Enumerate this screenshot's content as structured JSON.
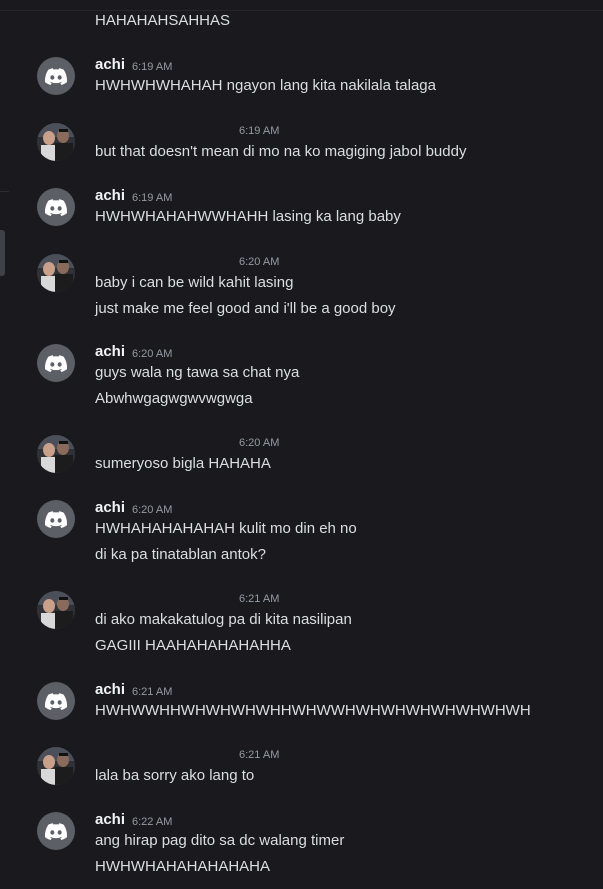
{
  "messages": [
    {
      "type": "text-only",
      "text": "HAHAHAHSAHHAS"
    },
    {
      "type": "group",
      "author": "achi",
      "time": "6:19 AM",
      "avatar_icon": "discord-logo-icon",
      "lines": [
        "HWHWHWHAHAH ngayon lang kita nakilala talaga"
      ]
    },
    {
      "type": "group-noname",
      "time": "6:19 AM",
      "avatar_icon": "user-photo-avatar",
      "lines": [
        "but that doesn't mean di mo na ko magiging jabol buddy"
      ]
    },
    {
      "type": "group",
      "author": "achi",
      "time": "6:19 AM",
      "avatar_icon": "discord-logo-icon",
      "lines": [
        "HWHWHAHAHWWHAHH lasing ka lang baby"
      ]
    },
    {
      "type": "group-noname",
      "time": "6:20 AM",
      "avatar_icon": "user-photo-avatar",
      "lines": [
        "baby i can be wild kahit lasing",
        "just make me feel good and i'll be a good boy"
      ]
    },
    {
      "type": "group",
      "author": "achi",
      "time": "6:20 AM",
      "avatar_icon": "discord-logo-icon",
      "lines": [
        "guys wala ng tawa sa chat nya",
        "Abwhwgagwgwvwgwga"
      ]
    },
    {
      "type": "group-noname",
      "time": "6:20 AM",
      "avatar_icon": "user-photo-avatar",
      "lines": [
        "sumeryoso bigla HAHAHA"
      ]
    },
    {
      "type": "group",
      "author": "achi",
      "time": "6:20 AM",
      "avatar_icon": "discord-logo-icon",
      "lines": [
        "HWHAHAHAHAHAH kulit mo din eh no",
        "di ka pa tinatablan antok?"
      ]
    },
    {
      "type": "group-noname",
      "time": "6:21 AM",
      "avatar_icon": "user-photo-avatar",
      "lines": [
        "di ako makakatulog pa di kita nasilipan",
        "GAGIII HAAHAHAHAHAHHA"
      ]
    },
    {
      "type": "group",
      "author": "achi",
      "time": "6:21 AM",
      "avatar_icon": "discord-logo-icon",
      "lines": [
        "HWHWWHHWHWHWHWHHWHWWHWHWHWHWHWHWHWH"
      ]
    },
    {
      "type": "group-noname",
      "time": "6:21 AM",
      "avatar_icon": "user-photo-avatar",
      "lines": [
        "lala ba sorry ako lang to"
      ]
    },
    {
      "type": "group",
      "author": "achi",
      "time": "6:22 AM",
      "avatar_icon": "discord-logo-icon",
      "lines": [
        "ang hirap pag dito sa dc walang timer",
        "HWHWHAHAHAHAHAHA"
      ]
    }
  ],
  "colors": {
    "background": "#1a1a1e",
    "username": "#f2f3f5",
    "message_text": "#dbdee1",
    "timestamp": "#949ba4",
    "discord_avatar_bg": "#5c5f66"
  }
}
